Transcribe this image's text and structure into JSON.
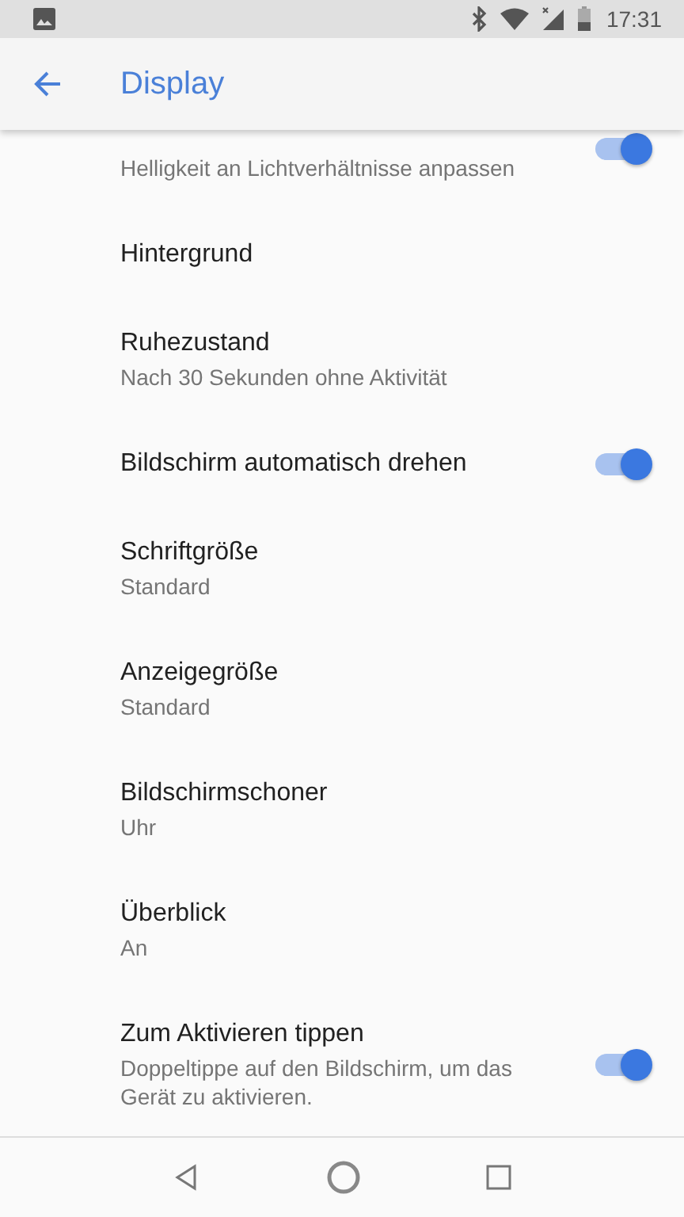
{
  "status_bar": {
    "time": "17:31"
  },
  "app_bar": {
    "title": "Display"
  },
  "settings": [
    {
      "kind": "switch",
      "summary": "Helligkeit an Lichtverhältnisse anpassen",
      "on": true
    },
    {
      "kind": "text",
      "title": "Hintergrund"
    },
    {
      "kind": "text",
      "title": "Ruhezustand",
      "summary": "Nach 30 Sekunden ohne Aktivität"
    },
    {
      "kind": "switch",
      "title": "Bildschirm automatisch drehen",
      "on": true
    },
    {
      "kind": "text",
      "title": "Schriftgröße",
      "summary": "Standard"
    },
    {
      "kind": "text",
      "title": "Anzeigegröße",
      "summary": "Standard"
    },
    {
      "kind": "text",
      "title": "Bildschirmschoner",
      "summary": "Uhr"
    },
    {
      "kind": "text",
      "title": "Überblick",
      "summary": "An"
    },
    {
      "kind": "switch",
      "title": "Zum Aktivieren tippen",
      "summary": "Doppeltippe auf den Bildschirm, um das Gerät zu aktivieren.",
      "on": true
    }
  ]
}
